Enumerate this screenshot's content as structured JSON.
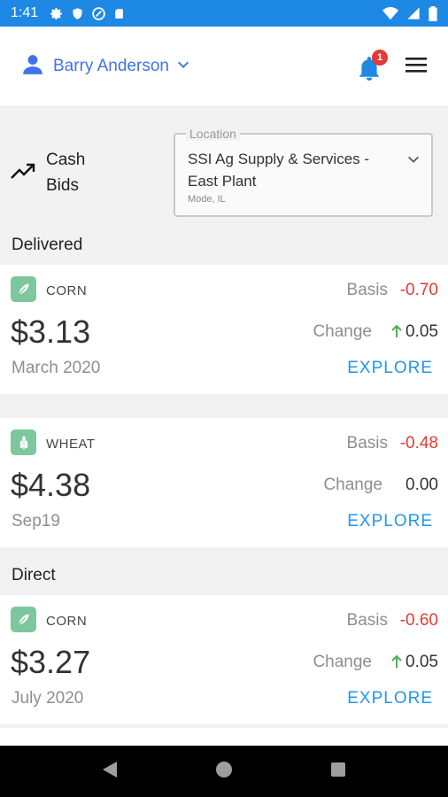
{
  "status_bar": {
    "time": "1:41",
    "left_icons": [
      "gear-icon",
      "shield-icon",
      "sync-icon",
      "sd-card-icon"
    ],
    "right_icons": [
      "wifi-icon",
      "cell-signal-icon",
      "battery-icon"
    ]
  },
  "header": {
    "user_name": "Barry Anderson",
    "notification_count": "1",
    "accent_color": "#3f73e8"
  },
  "title": {
    "line1": "Cash",
    "line2": "Bids"
  },
  "location": {
    "legend": "Location",
    "name": "SSI Ag Supply & Services - East Plant",
    "sub": "Mode, IL"
  },
  "sections": [
    {
      "label": "Delivered",
      "cards": [
        {
          "crop": "CORN",
          "basis_label": "Basis",
          "basis": "-0.70",
          "price": "$3.13",
          "change_label": "Change",
          "change": "0.05",
          "trend": "up",
          "period": "March 2020",
          "action": "EXPLORE"
        },
        {
          "crop": "WHEAT",
          "basis_label": "Basis",
          "basis": "-0.48",
          "price": "$4.38",
          "change_label": "Change",
          "change": "0.00",
          "trend": "none",
          "period": "Sep19",
          "action": "EXPLORE"
        }
      ]
    },
    {
      "label": "Direct",
      "cards": [
        {
          "crop": "CORN",
          "basis_label": "Basis",
          "basis": "-0.60",
          "price": "$3.27",
          "change_label": "Change",
          "change": "0.05",
          "trend": "up",
          "period": "July 2020",
          "action": "EXPLORE"
        }
      ]
    }
  ],
  "colors": {
    "status_bar": "#1e88e5",
    "negative": "#e53935",
    "positive": "#4caf50",
    "link": "#2196f3",
    "crop_icon": "#7cc79d"
  }
}
